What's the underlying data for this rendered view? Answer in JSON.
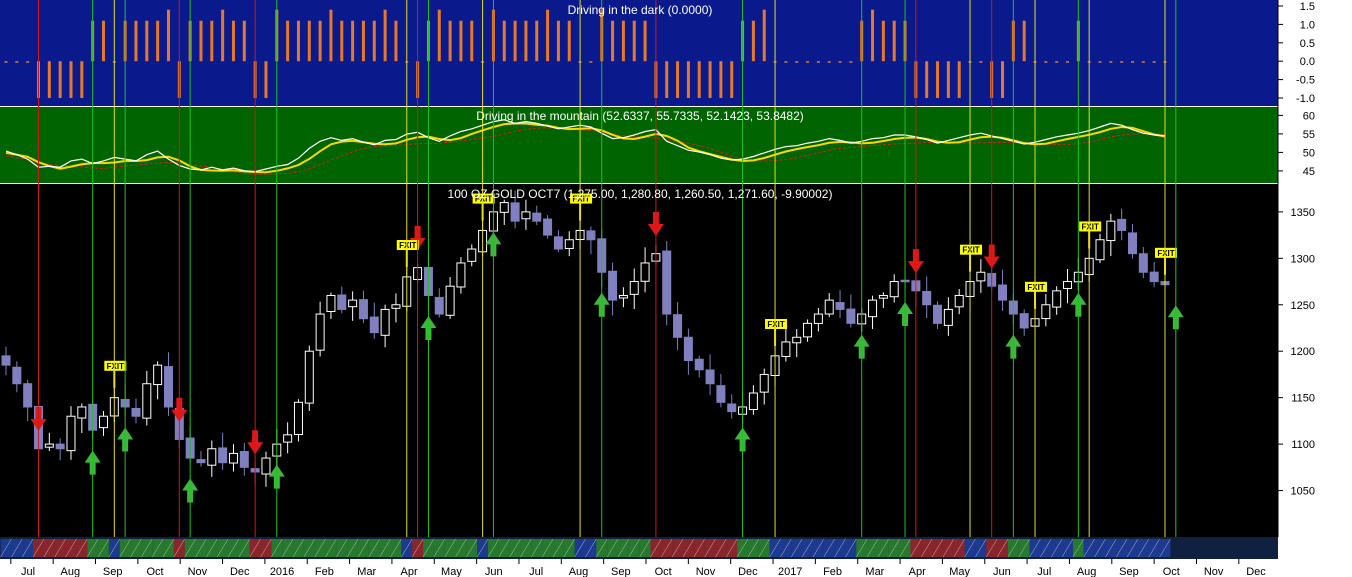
{
  "panels": {
    "dark": {
      "title": "Driving in the dark (0.0000)",
      "bg": "#0a1a8c",
      "bar_color": "#e6782c",
      "ticks": [
        "1.5",
        "1.0",
        "0.5",
        "0.0",
        "-0.5",
        "-1.0"
      ]
    },
    "mountain": {
      "title": "Driving in the mountain (52.6337, 55.7335, 52.1423, 53.8482)",
      "bg": "#006400",
      "ticks": [
        "60",
        "55",
        "50",
        "45"
      ],
      "line_colors": [
        "#ffffff",
        "#ffd700",
        "#d02020"
      ]
    },
    "price": {
      "title": "100 OZ GOLD OCT7 (1,275.00, 1,280.80, 1,260.50, 1,271.60, -9.90002)",
      "bg": "#000000",
      "ticks": [
        "1350",
        "1300",
        "1250",
        "1200",
        "1150",
        "1100",
        "1050"
      ],
      "exit_label": "FXIT",
      "up_color": "#ffffff",
      "down_color": "#8080c0"
    }
  },
  "x_axis": {
    "labels": [
      "Jul",
      "Aug",
      "Sep",
      "Oct",
      "Nov",
      "Dec",
      "2016",
      "Feb",
      "Mar",
      "Apr",
      "May",
      "Jun",
      "Jul",
      "Aug",
      "Sep",
      "Oct",
      "Nov",
      "Dec",
      "2017",
      "Feb",
      "Mar",
      "Apr",
      "May",
      "Jun",
      "Jul",
      "Aug",
      "Sep",
      "Oct",
      "Nov",
      "Dec"
    ]
  },
  "chart_data": {
    "type": "candlestick",
    "title": "100 OZ GOLD OCT7",
    "last_bar": {
      "open": 1275.0,
      "high": 1280.8,
      "low": 1260.5,
      "close": 1271.6,
      "change": -9.90002
    },
    "x_range": [
      "2015-07",
      "2017-12"
    ],
    "ylim": [
      1000,
      1380
    ],
    "closes": [
      1185,
      1165,
      1140,
      1095,
      1100,
      1095,
      1130,
      1140,
      1115,
      1130,
      1150,
      1140,
      1130,
      1165,
      1185,
      1140,
      1105,
      1085,
      1080,
      1095,
      1080,
      1090,
      1075,
      1070,
      1085,
      1100,
      1110,
      1145,
      1200,
      1240,
      1260,
      1245,
      1255,
      1235,
      1220,
      1245,
      1250,
      1280,
      1290,
      1260,
      1240,
      1270,
      1295,
      1310,
      1330,
      1350,
      1360,
      1340,
      1350,
      1340,
      1325,
      1310,
      1320,
      1330,
      1320,
      1285,
      1255,
      1260,
      1275,
      1295,
      1305,
      1240,
      1215,
      1190,
      1180,
      1165,
      1145,
      1135,
      1140,
      1155,
      1175,
      1195,
      1210,
      1215,
      1230,
      1240,
      1255,
      1245,
      1230,
      1240,
      1255,
      1260,
      1275,
      1275,
      1265,
      1250,
      1230,
      1245,
      1260,
      1275,
      1285,
      1270,
      1255,
      1240,
      1225,
      1235,
      1250,
      1265,
      1275,
      1285,
      1300,
      1320,
      1340,
      1330,
      1305,
      1285,
      1275,
      1271.6
    ],
    "long_entries": 13,
    "short_entries": 7,
    "exits": 9,
    "dark_indicator_range": [
      -1.0,
      1.5
    ],
    "mountain_indicator": {
      "values": [
        52.6337,
        55.7335,
        52.1423,
        53.8482
      ],
      "range": [
        42,
        62
      ]
    },
    "grid": false
  }
}
